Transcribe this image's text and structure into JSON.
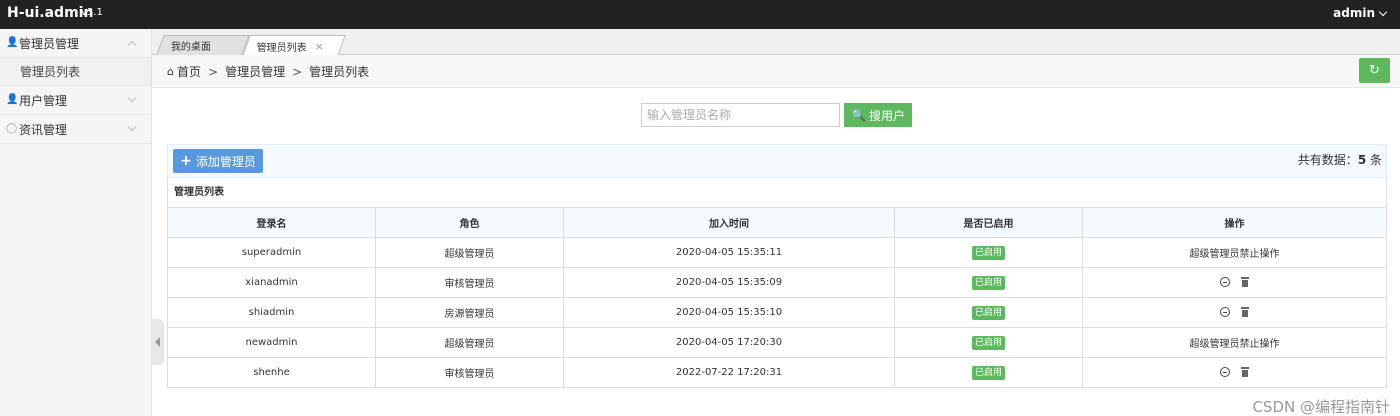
{
  "topbar": {
    "brand": "H-ui.admin",
    "version": "v3.1",
    "user": "admin"
  },
  "sidebar": {
    "groups": [
      {
        "label": "管理员管理",
        "icon": "user-icon",
        "expanded": true,
        "items": [
          {
            "label": "管理员列表"
          }
        ]
      },
      {
        "label": "用户管理",
        "icon": "user-icon",
        "expanded": false
      },
      {
        "label": "资讯管理",
        "icon": "comment-icon",
        "expanded": false
      }
    ]
  },
  "tabs": [
    {
      "label": "我的桌面",
      "active": false
    },
    {
      "label": "管理员列表",
      "active": true,
      "close": "×"
    }
  ],
  "breadcrumb": {
    "home": "首页",
    "sep": ">",
    "items": [
      "管理员管理",
      "管理员列表"
    ]
  },
  "search": {
    "placeholder": "输入管理员名称",
    "value": "",
    "button_label": "搜用户"
  },
  "toolbar": {
    "add_label": "添加管理员",
    "count_prefix": "共有数据：",
    "count_value": "5",
    "count_suffix": " 条"
  },
  "table": {
    "caption": "管理员列表",
    "columns": [
      "登录名",
      "角色",
      "加入时间",
      "是否已启用",
      "操作"
    ],
    "rows": [
      {
        "name": "superadmin",
        "role": "超级管理员",
        "time": "2020-04-05 15:35:11",
        "status": "已启用",
        "op": "超级管理员禁止操作"
      },
      {
        "name": "xianadmin",
        "role": "审核管理员",
        "time": "2020-04-05 15:35:09",
        "status": "已启用",
        "op": ""
      },
      {
        "name": "shiadmin",
        "role": "房源管理员",
        "time": "2020-04-05 15:35:10",
        "status": "已启用",
        "op": ""
      },
      {
        "name": "newadmin",
        "role": "超级管理员",
        "time": "2020-04-05 17:20:30",
        "status": "已启用",
        "op": "超级管理员禁止操作"
      },
      {
        "name": "shenhe",
        "role": "审核管理员",
        "time": "2022-07-22 17:20:31",
        "status": "已启用",
        "op": ""
      }
    ]
  },
  "watermark": "CSDN @编程指南针",
  "colors": {
    "topbar": "#222222",
    "success": "#5eb95e",
    "primary": "#5a98de"
  }
}
